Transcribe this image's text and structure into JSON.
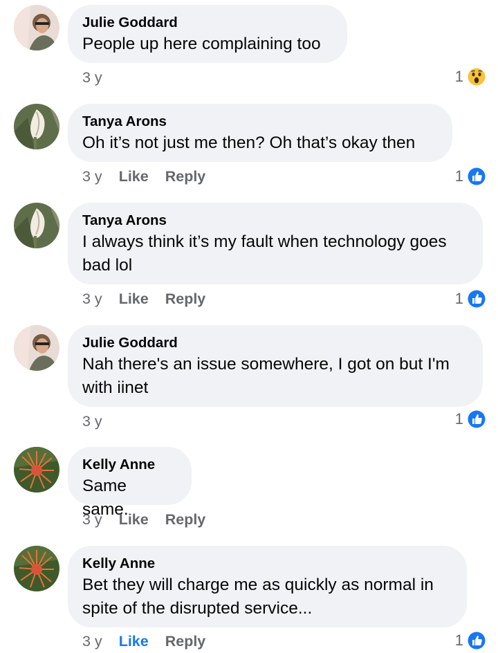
{
  "comments": [
    {
      "avatar": "julie-avatar",
      "name": "Julie Goddard",
      "lines": [
        "People up here complaining too"
      ],
      "time": "3 y",
      "like": "",
      "reply": "",
      "reaction_count": "1",
      "reaction_icon": "wow-reaction-icon"
    },
    {
      "avatar": "tanya-avatar",
      "name": "Tanya Arons",
      "lines": [
        "Oh it’s not just me then?  Oh that’s okay then"
      ],
      "time": "3 y",
      "like": "Like",
      "reply": "Reply",
      "reaction_count": "1",
      "reaction_icon": "like-reaction-icon"
    },
    {
      "avatar": "tanya-avatar",
      "name": "Tanya Arons",
      "lines": [
        "I always think it’s my fault when technology goes",
        "bad lol"
      ],
      "time": "3 y",
      "like": "Like",
      "reply": "Reply",
      "reaction_count": "1",
      "reaction_icon": "like-reaction-icon"
    },
    {
      "avatar": "julie-avatar",
      "name": "Julie Goddard",
      "lines": [
        "Nah there's an issue somewhere, I got on but I'm",
        "with iinet"
      ],
      "time": "3 y",
      "like": "",
      "reply": "",
      "reaction_count": "1",
      "reaction_icon": "like-reaction-icon"
    },
    {
      "avatar": "kelly-avatar",
      "name": "Kelly Anne",
      "lines": [
        "Same same."
      ],
      "time": "3 y",
      "like": "Like",
      "reply": "Reply",
      "reaction_count": "",
      "reaction_icon": ""
    },
    {
      "avatar": "kelly-avatar",
      "name": "Kelly Anne",
      "lines": [
        "Bet they will charge me as quickly as normal in",
        "spite of the disrupted service..."
      ],
      "time": "3 y",
      "like": "Like",
      "like_active": true,
      "reply": "Reply",
      "reaction_count": "1",
      "reaction_icon": "like-reaction-icon"
    }
  ],
  "colors": {
    "bubble": "#f0f2f5",
    "name": "#050505",
    "meta": "#65676b",
    "liked": "#1877f2"
  }
}
